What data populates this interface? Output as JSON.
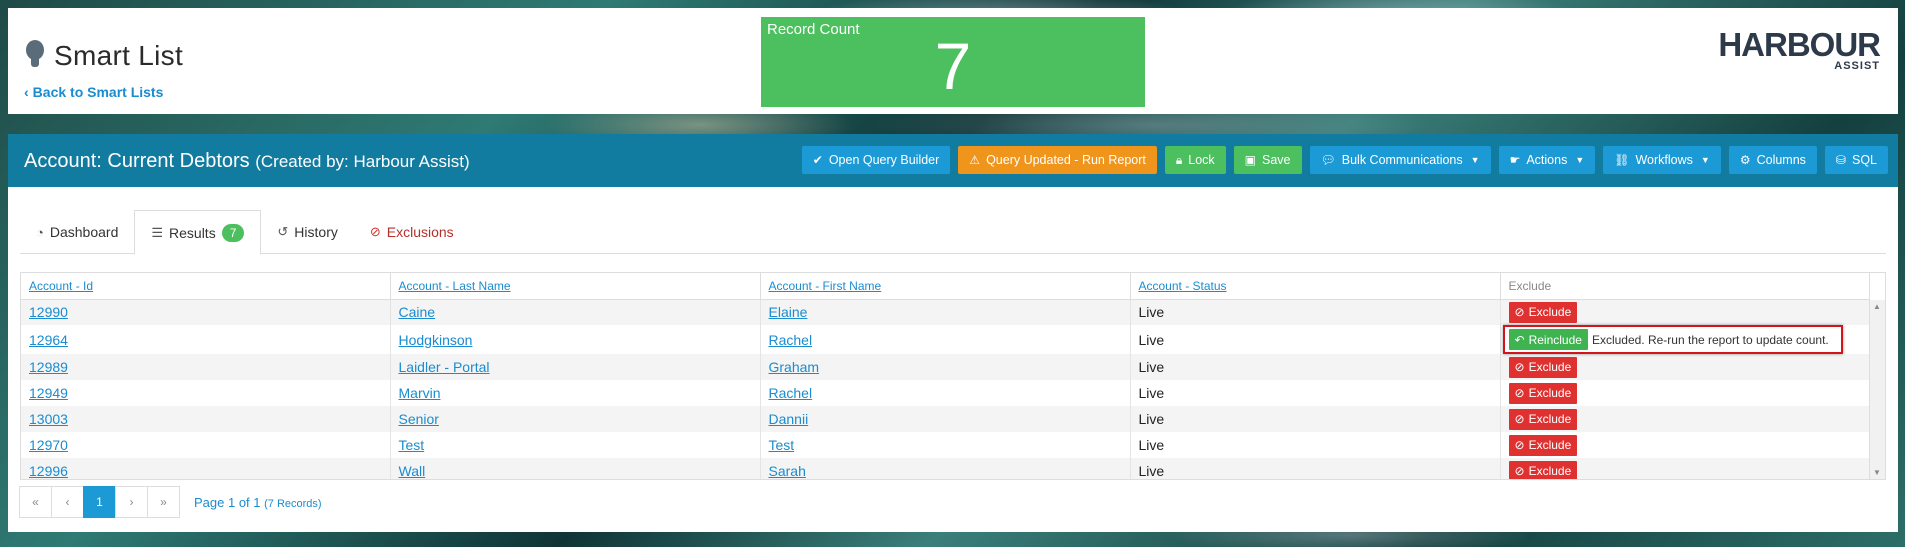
{
  "header": {
    "title": "Smart List",
    "back_link": "Back to Smart Lists",
    "record_count_label": "Record Count",
    "record_count_value": "7",
    "logo_main": "HARBOUR",
    "logo_sub": "ASSIST"
  },
  "panel": {
    "title": "Account: Current Debtors",
    "subtitle": "(Created by: Harbour Assist)"
  },
  "toolbar": {
    "open_query_builder": "Open Query Builder",
    "query_updated": "Query Updated - Run Report",
    "lock": "Lock",
    "save": "Save",
    "bulk_communications": "Bulk Communications",
    "actions": "Actions",
    "workflows": "Workflows",
    "columns": "Columns",
    "sql": "SQL"
  },
  "tabs": {
    "dashboard": "Dashboard",
    "results": "Results",
    "results_count": "7",
    "history": "History",
    "exclusions": "Exclusions"
  },
  "table": {
    "headers": [
      "Account - Id",
      "Account - Last Name",
      "Account - First Name",
      "Account - Status",
      "Exclude"
    ],
    "exclude_label": "Exclude",
    "reinclude_label": "Reinclude",
    "excluded_note": "Excluded. Re-run the report to update count.",
    "rows": [
      {
        "id": "12990",
        "last": "Caine",
        "first": "Elaine",
        "status": "Live"
      },
      {
        "id": "12964",
        "last": "Hodgkinson",
        "first": "Rachel",
        "status": "Live"
      },
      {
        "id": "12989",
        "last": "Laidler - Portal",
        "first": "Graham",
        "status": "Live"
      },
      {
        "id": "12949",
        "last": "Marvin",
        "first": "Rachel",
        "status": "Live"
      },
      {
        "id": "13003",
        "last": "Senior",
        "first": "Dannii",
        "status": "Live"
      },
      {
        "id": "12970",
        "last": "Test",
        "first": "Test",
        "status": "Live"
      },
      {
        "id": "12996",
        "last": "Wall",
        "first": "Sarah",
        "status": "Live"
      }
    ]
  },
  "pager": {
    "first": "«",
    "prev": "‹",
    "current": "1",
    "next": "›",
    "last": "»",
    "info": "Page 1 of 1",
    "records": "(7 Records)"
  }
}
